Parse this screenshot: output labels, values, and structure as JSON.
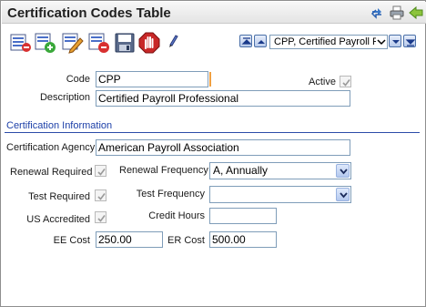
{
  "window": {
    "title": "Certification Codes Table"
  },
  "titlebar_icons": [
    "refresh-icon",
    "print-icon",
    "back-arrow-icon"
  ],
  "toolbar": {
    "icons": [
      "view-list-icon",
      "add-record-icon",
      "edit-record-icon",
      "delete-record-icon",
      "save-icon",
      "stop-icon",
      "pen-icon"
    ]
  },
  "navigation": {
    "record_selector": "CPP, Certified Payroll Professional"
  },
  "form": {
    "code": {
      "label": "Code",
      "value": "CPP"
    },
    "active": {
      "label": "Active",
      "checked": true
    },
    "description": {
      "label": "Description",
      "value": "Certified Payroll Professional"
    },
    "section_title": "Certification Information",
    "agency": {
      "label": "Certification Agency",
      "value": "American Payroll Association"
    },
    "renewal_required": {
      "label": "Renewal Required",
      "checked": true
    },
    "renewal_frequency": {
      "label": "Renewal Frequency",
      "value": "A, Annually"
    },
    "test_required": {
      "label": "Test Required",
      "checked": true
    },
    "test_frequency": {
      "label": "Test Frequency",
      "value": ""
    },
    "us_accredited": {
      "label": "US Accredited",
      "checked": true
    },
    "credit_hours": {
      "label": "Credit Hours",
      "value": ""
    },
    "ee_cost": {
      "label": "EE Cost",
      "value": "250.00"
    },
    "er_cost": {
      "label": "ER Cost",
      "value": "500.00"
    }
  }
}
